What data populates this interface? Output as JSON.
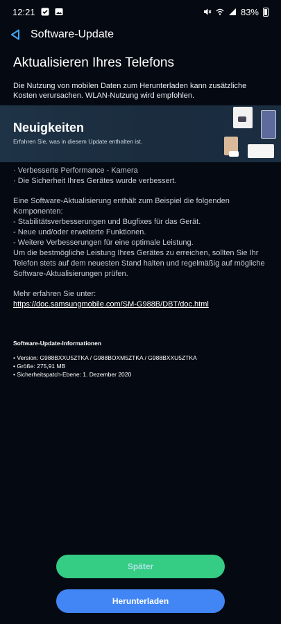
{
  "status_bar": {
    "time": "12:21",
    "battery_text": "83%",
    "left_icons": [
      "check-notification-icon",
      "image-notification-icon"
    ],
    "right_icons": [
      "mute-icon",
      "wifi-icon",
      "signal-icon",
      "battery-icon"
    ]
  },
  "header": {
    "title": "Software-Update",
    "accent_color": "#3ea8ff"
  },
  "page": {
    "title": "Aktualisieren Ihres Telefons",
    "data_notice": "Die Nutzung von mobilen Daten zum Herunterladen kann zusätzliche Kosten verursachen. WLAN-Nutzung wird empfohlen."
  },
  "news": {
    "title": "Neuigkeiten",
    "subtitle": "Erfahren Sie, was in diesem Update enthalten ist."
  },
  "changelog": {
    "highlights": [
      "· Verbesserte Performance - Kamera",
      "· Die Sicherheit Ihres Gerätes wurde verbessert."
    ],
    "intro_lines": [
      "Eine Software-Aktualisierung enthält zum Beispiel die folgenden",
      "Komponenten:",
      " - Stabilitätsverbesserungen und Bugfixes für das Gerät.",
      " - Neue und/oder erweiterte Funktionen.",
      " - Weitere Verbesserungen für eine optimale Leistung.",
      "Um die bestmögliche Leistung Ihres Gerätes zu erreichen, sollten Sie Ihr",
      "Telefon stets auf dem neuesten Stand halten und regelmäßig auf mögliche",
      "Software-Aktualisierungen prüfen."
    ],
    "more_label": "Mehr erfahren Sie unter:",
    "link": "https://doc.samsungmobile.com/SM-G988B/DBT/doc.html"
  },
  "info": {
    "title": "Software-Update-Informationen",
    "version": "• Version: G988BXXU5ZTKA / G988BOXM5ZTKA / G988BXXU5ZTKA",
    "size": "• Größe: 275,91 MB",
    "patch": "• Sicherheitspatch-Ebene: 1. Dezember 2020"
  },
  "buttons": {
    "later": "Später",
    "download": "Herunterladen",
    "later_color": "#35cc84",
    "download_color": "#4286f5"
  }
}
